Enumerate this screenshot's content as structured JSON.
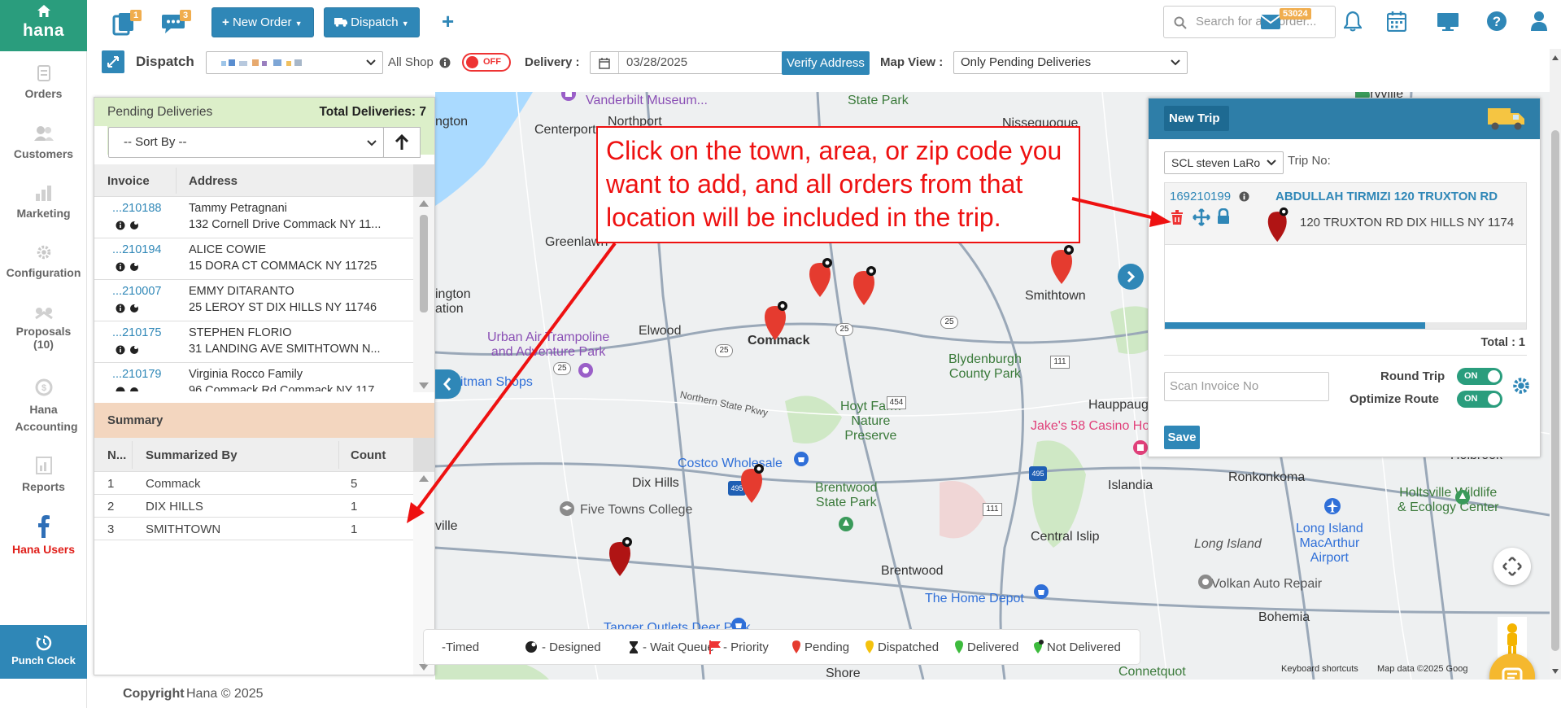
{
  "app": {
    "logo": "hana"
  },
  "sidebar": {
    "items": [
      {
        "label": "Orders"
      },
      {
        "label": "Customers"
      },
      {
        "label": "Marketing"
      },
      {
        "label": "Configuration"
      },
      {
        "label": "Proposals",
        "count": "(10)"
      },
      {
        "label": "Hana Accounting"
      },
      {
        "label": "Reports"
      },
      {
        "label": "Hana Users"
      }
    ],
    "punch_clock": "Punch Clock"
  },
  "topbar": {
    "badge_orders": "1",
    "badge_chat": "3",
    "new_order": "New Order",
    "dispatch": "Dispatch",
    "search_placeholder": "Search for any order...",
    "mail_badge": "53024"
  },
  "filters": {
    "dispatch_label": "Dispatch",
    "all_shop_label": "All Shop",
    "all_shop_toggle": "OFF",
    "delivery_label": "Delivery :",
    "delivery_date": "03/28/2025",
    "verify_address": "Verify Address",
    "map_view_label": "Map View :",
    "map_view_value": "Only Pending Deliveries"
  },
  "pending": {
    "title": "Pending Deliveries",
    "total": "Total Deliveries: 7",
    "sort_placeholder": "-- Sort By --",
    "col_invoice": "Invoice",
    "col_address": "Address",
    "rows": [
      {
        "invoice": "...210188",
        "name": "Tammy Petragnani",
        "address": "132 Cornell Drive Commack NY 11..."
      },
      {
        "invoice": "...210194",
        "name": "ALICE COWIE",
        "address": "15 DORA CT COMMACK NY 11725"
      },
      {
        "invoice": "...210007",
        "name": "EMMY DITARANTO",
        "address": "25 LEROY ST DIX HILLS NY 11746"
      },
      {
        "invoice": "...210175",
        "name": "STEPHEN FLORIO",
        "address": "31 LANDING AVE SMITHTOWN N..."
      },
      {
        "invoice": "...210179",
        "name": "Virginia Rocco Family",
        "address": "96 Commack Rd Commack NY 117..."
      }
    ]
  },
  "summary": {
    "title": "Summary",
    "col_no": "N...",
    "col_by": "Summarized By",
    "col_count": "Count",
    "rows": [
      {
        "no": "1",
        "by": "Commack",
        "count": "5"
      },
      {
        "no": "2",
        "by": "DIX HILLS",
        "count": "1"
      },
      {
        "no": "3",
        "by": "SMITHTOWN",
        "count": "1"
      }
    ]
  },
  "trip": {
    "new_trip": "New Trip",
    "driver": "SCL steven LaRo",
    "trip_no_label": "Trip No:",
    "stop_invoice": "169210199",
    "stop_name": "ABDULLAH TIRMIZI 120 TRUXTON RD",
    "stop_address": "120 TRUXTON RD DIX HILLS NY 1174",
    "total": "Total : 1",
    "scan_placeholder": "Scan Invoice No",
    "round_trip_label": "Round Trip",
    "round_trip_value": "ON",
    "optimize_label": "Optimize Route",
    "optimize_value": "ON",
    "save": "Save"
  },
  "annotation": {
    "text": "Click on the town, area, or zip code you want to add, and all orders from that location will be included in the trip."
  },
  "map": {
    "labels": {
      "vanderbilt": "Vanderbilt Museum...",
      "state_park": "State Park",
      "northport": "Northport",
      "centerport": "Centerport",
      "huntington": "ngton",
      "greenlawn": "Greenlawn",
      "smithtown": "Smithtown",
      "elwood": "Elwood",
      "commack": "Commack",
      "ington_station": "ington\nation",
      "urban_air": "Urban Air Trampoline\nand Adventure Park",
      "blydenburgh": "Blydenburgh\nCounty Park",
      "whitman": "hitman Shops",
      "northern_state": "Northern State Pkwy",
      "hoyt": "Hoyt Farm\nNature\nPreserve",
      "hauppauge": "Hauppauge",
      "jakes": "Jake's 58 Casino Ho",
      "costco": "Costco Wholesale",
      "dix_hills": "Dix Hills",
      "brentwood_sp": "Brentwood\nState Park",
      "islandia": "Islandia",
      "ronkonkoma": "Ronkonkoma",
      "five_towns": "Five Towns College",
      "ville": "ville",
      "central_islip": "Central Islip",
      "long_island": "Long Island",
      "li_macarthur": "Long Island\nMacArthur\nAirport",
      "holtsville": "Holtsville Wildlife\n& Ecology Center",
      "brentwood": "Brentwood",
      "home_depot": "The Home Depot",
      "volkan": "Volkan Auto Repair",
      "bohemia": "Bohemia",
      "tanger": "Tanger Outlets Deer Park",
      "shore": "Shore",
      "connetquot": "Connetquot",
      "terryville": "Terryville",
      "nissequogue": "Nissequogue",
      "holbrook": "Holbrook",
      "keyboard": "Keyboard shortcuts",
      "mapdata": "Map data ©2025 Goog"
    },
    "shields": [
      "25",
      "25",
      "25",
      "25",
      "111",
      "454",
      "111",
      "495",
      "495",
      "454",
      "111"
    ]
  },
  "legend": {
    "timed": "-Timed",
    "designed": "- Designed",
    "wait_queue": "- Wait Queue",
    "priority": "- Priority",
    "pending": "Pending",
    "dispatched": "Dispatched",
    "delivered": "Delivered",
    "not_delivered": "Not Delivered"
  },
  "footer": {
    "copyright_bold": "Copyright",
    "copyright_rest": "Hana © 2025"
  },
  "colors": {
    "brand_green": "#2a9d7d",
    "primary_blue": "#2f87b7",
    "annotation_red": "#e11111"
  }
}
